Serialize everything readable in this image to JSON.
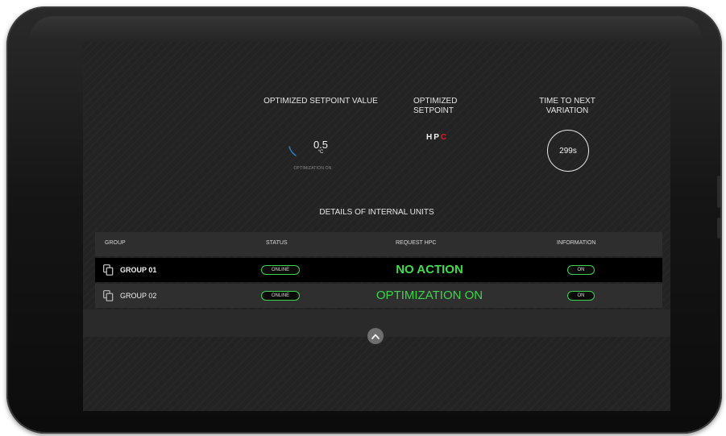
{
  "setpoint": {
    "title": "OPTIMIZED SETPOINT VALUE",
    "value": "0.5",
    "unit": "°C",
    "caption": "OPTIMIZATION ON"
  },
  "optimized": {
    "title": "OPTIMIZED SETPOINT",
    "mode_main": "HP",
    "mode_accent": "C",
    "accent_color": "#e02020"
  },
  "timer": {
    "title": "TIME TO NEXT VARIATION",
    "value": "299s"
  },
  "details": {
    "title": "DETAILS OF INTERNAL UNITS",
    "headers": {
      "group": "GROUP",
      "status": "STATUS",
      "request": "REQUEST HPC",
      "information": "INFORMATION"
    },
    "rows": [
      {
        "group": "GROUP 01",
        "status": "ONLINE",
        "request": "NO ACTION",
        "information": "ON"
      },
      {
        "group": "GROUP 02",
        "status": "ONLINE",
        "request": "OPTIMIZATION ON",
        "information": "ON"
      }
    ]
  },
  "colors": {
    "accent_green": "#3bd64a",
    "screen_bg": "#232323",
    "selected_row_bg": "#000000"
  },
  "icons": {
    "group": "copy-group-icon",
    "collapse": "chevron-up-icon"
  }
}
